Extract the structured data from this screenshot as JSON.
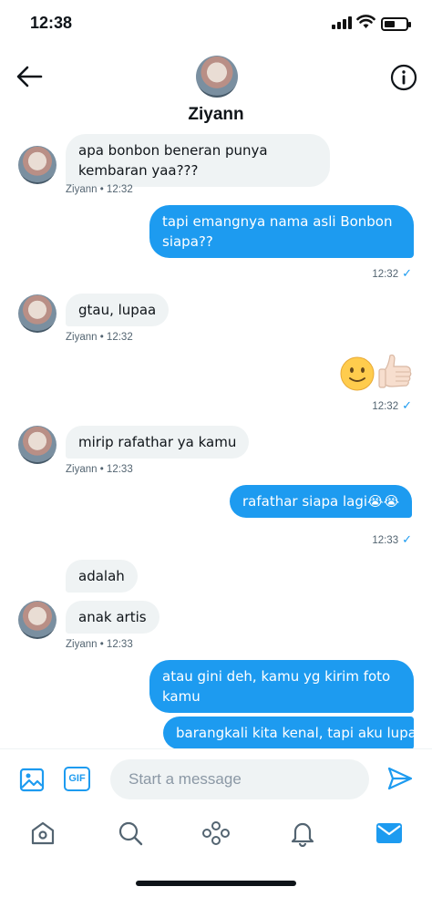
{
  "status": {
    "time": "12:38"
  },
  "header": {
    "name": "Ziyann"
  },
  "messages": {
    "m1": {
      "text1": "apa bonbon beneran punya",
      "text2": "kembaran yaa???",
      "meta": "Ziyann • 12:32"
    },
    "m2": {
      "text1": "tapi emangnya nama asli Bonbon",
      "text2": "siapa??",
      "time": "12:32"
    },
    "m3": {
      "text": "gtau, lupaa",
      "meta": "Ziyann • 12:32"
    },
    "m4": {
      "emojis": [
        "slightly-smiling-face",
        "thumbs-up"
      ],
      "time": "12:32"
    },
    "m5": {
      "text": "mirip rafathar ya kamu",
      "meta": "Ziyann • 12:33"
    },
    "m6": {
      "text": "rafathar siapa lagi😭😭",
      "time": "12:33"
    },
    "m7": {
      "text": "adalah"
    },
    "m8": {
      "text": "anak artis",
      "meta": "Ziyann • 12:33"
    },
    "m9": {
      "text1": "atau gini deh, kamu yg kirim foto",
      "text2": "kamu"
    },
    "m10": {
      "text": "barangkali kita kenal, tapi aku lupa"
    }
  },
  "composer": {
    "placeholder": "Start a message",
    "gif_label": "GIF"
  },
  "tabs": [
    "home-icon",
    "search-icon",
    "spaces-icon",
    "notifications-icon",
    "messages-icon"
  ],
  "colors": {
    "accent": "#1d9bf0",
    "incoming_bubble": "#eff3f4",
    "meta_text": "#536471"
  }
}
